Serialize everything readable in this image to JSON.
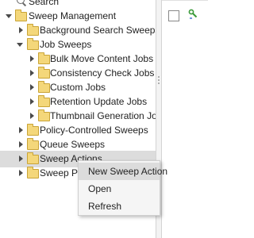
{
  "tree": {
    "search_label": "Search",
    "items": [
      {
        "label": "Sweep Management",
        "state": "expanded"
      },
      {
        "label": "Background Search Sweeps",
        "state": "collapsed"
      },
      {
        "label": "Job Sweeps",
        "state": "expanded"
      },
      {
        "label": "Bulk Move Content Jobs",
        "state": "collapsed"
      },
      {
        "label": "Consistency Check Jobs",
        "state": "collapsed"
      },
      {
        "label": "Custom Jobs",
        "state": "collapsed"
      },
      {
        "label": "Retention Update Jobs",
        "state": "collapsed"
      },
      {
        "label": "Thumbnail Generation Jobs",
        "state": "collapsed"
      },
      {
        "label": "Policy-Controlled Sweeps",
        "state": "collapsed"
      },
      {
        "label": "Queue Sweeps",
        "state": "collapsed"
      },
      {
        "label": "Sweep Actions",
        "state": "collapsed",
        "selected": true
      },
      {
        "label": "Sweep Policies",
        "state": "collapsed"
      }
    ]
  },
  "context_menu": {
    "items": [
      {
        "label": "New Sweep Action",
        "highlighted": true
      },
      {
        "label": "Open"
      },
      {
        "label": "Refresh"
      }
    ]
  },
  "colors": {
    "folder": "#f4d77a",
    "selection": "#dcdcdc",
    "wrench_icon": "#3a9a3a"
  }
}
